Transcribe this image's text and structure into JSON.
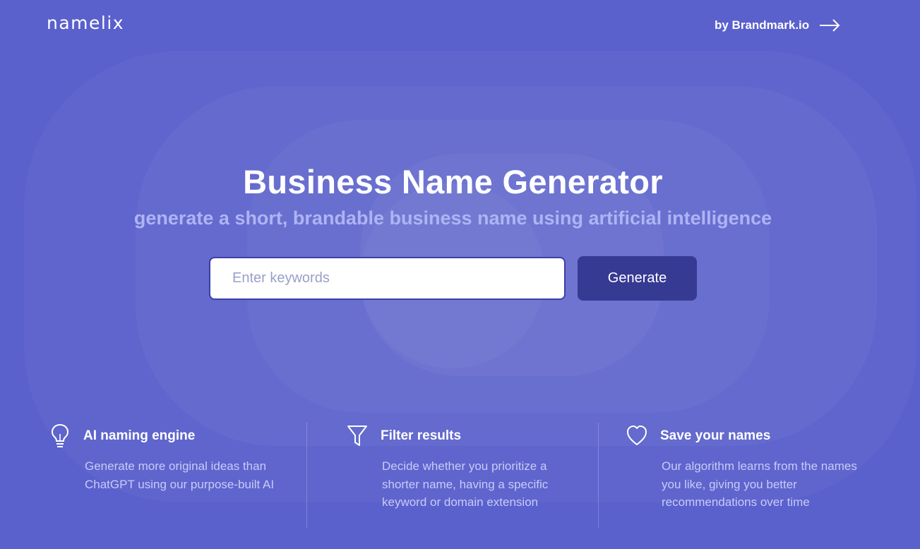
{
  "header": {
    "logo": "namelix",
    "by_link": "by Brandmark.io"
  },
  "hero": {
    "title": "Business Name Generator",
    "subtitle": "generate a short, brandable business name using artificial intelligence"
  },
  "search": {
    "placeholder": "Enter keywords",
    "value": "",
    "button_label": "Generate"
  },
  "features": [
    {
      "icon": "lightbulb-icon",
      "title": "AI naming engine",
      "description": "Generate more original ideas than ChatGPT using our purpose-built AI"
    },
    {
      "icon": "filter-icon",
      "title": "Filter results",
      "description": "Decide whether you prioritize a shorter name, having a specific keyword or domain extension"
    },
    {
      "icon": "heart-icon",
      "title": "Save your names",
      "description": "Our algorithm learns from the names you like, giving you better recommendations over time"
    }
  ],
  "colors": {
    "background": "#5a60cc",
    "subtitle": "#aeb4f4",
    "button": "#363a93",
    "description": "#c7cbf7"
  }
}
